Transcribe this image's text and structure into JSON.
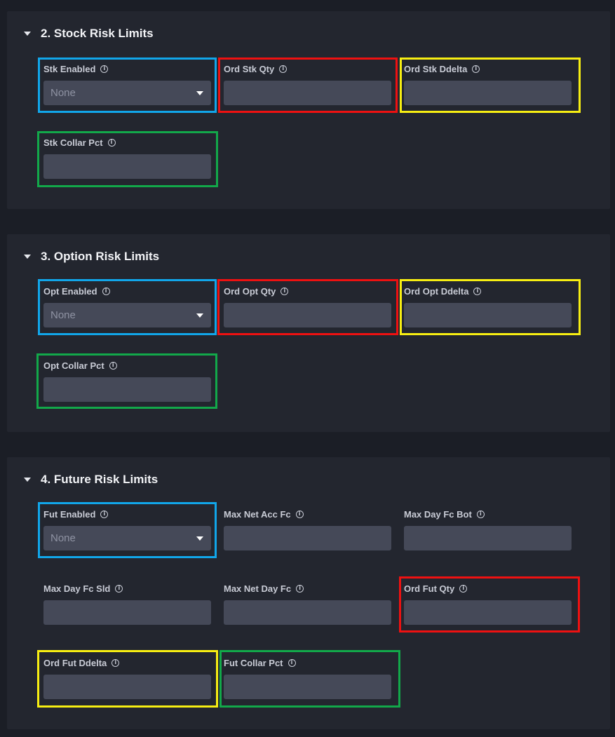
{
  "sections": [
    {
      "title": "2. Stock Risk Limits",
      "fields": {
        "enabled": {
          "label": "Stk Enabled",
          "value": "None"
        },
        "ord_qty": {
          "label": "Ord Stk Qty",
          "value": ""
        },
        "ord_ddelta": {
          "label": "Ord Stk Ddelta",
          "value": ""
        },
        "collar_pct": {
          "label": "Stk Collar Pct",
          "value": ""
        }
      }
    },
    {
      "title": "3. Option Risk Limits",
      "fields": {
        "enabled": {
          "label": "Opt Enabled",
          "value": "None"
        },
        "ord_qty": {
          "label": "Ord Opt Qty",
          "value": ""
        },
        "ord_ddelta": {
          "label": "Ord Opt Ddelta",
          "value": ""
        },
        "collar_pct": {
          "label": "Opt Collar Pct",
          "value": ""
        }
      }
    },
    {
      "title": "4. Future Risk Limits",
      "fields": {
        "enabled": {
          "label": "Fut Enabled",
          "value": "None"
        },
        "max_net_acc_fc": {
          "label": "Max Net Acc Fc",
          "value": ""
        },
        "max_day_fc_bot": {
          "label": "Max Day Fc Bot",
          "value": ""
        },
        "max_day_fc_sld": {
          "label": "Max Day Fc Sld",
          "value": ""
        },
        "max_net_day_fc": {
          "label": "Max Net Day Fc",
          "value": ""
        },
        "ord_qty": {
          "label": "Ord Fut Qty",
          "value": ""
        },
        "ord_ddelta": {
          "label": "Ord Fut Ddelta",
          "value": ""
        },
        "collar_pct": {
          "label": "Fut Collar Pct",
          "value": ""
        }
      }
    }
  ],
  "icons": {
    "info": "i"
  },
  "highlight_colors": {
    "blue": "#11a6ea",
    "red": "#ee1111",
    "yellow": "#f7ee12",
    "green": "#12a84a"
  }
}
